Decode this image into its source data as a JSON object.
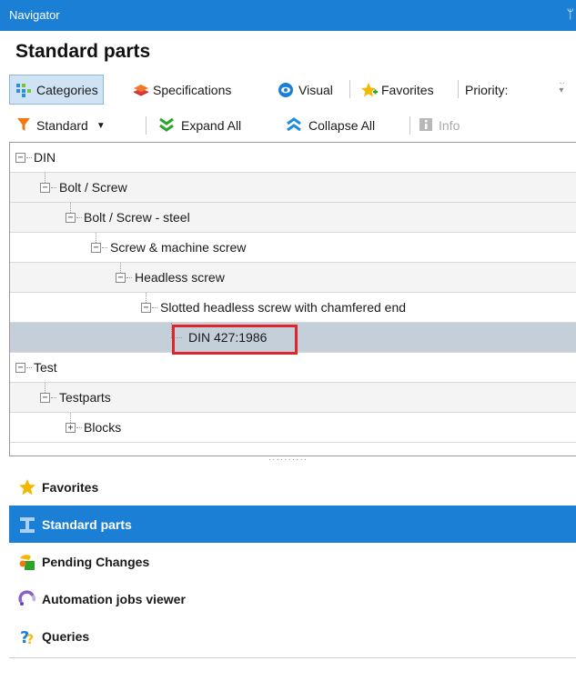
{
  "window": {
    "title": "Navigator",
    "pin_glyph": "ᛘ"
  },
  "panel_title": "Standard parts",
  "tabs": [
    {
      "label": "Categories",
      "icon": "categories-icon",
      "active": true
    },
    {
      "label": "Specifications",
      "icon": "specifications-icon"
    },
    {
      "label": "Visual",
      "icon": "visual-icon"
    },
    {
      "label": "Favorites",
      "icon": "favorites-icon"
    },
    {
      "label": "Priority:",
      "icon": ""
    }
  ],
  "toolbar": {
    "standard": "Standard",
    "expand_all": "Expand  All",
    "collapse_all": "Collapse All",
    "info": "Info"
  },
  "tree": [
    {
      "label": "DIN",
      "level": 0,
      "expander": "−"
    },
    {
      "label": "Bolt / Screw",
      "level": 1,
      "expander": "−"
    },
    {
      "label": "Bolt / Screw - steel",
      "level": 2,
      "expander": "−"
    },
    {
      "label": "Screw & machine screw",
      "level": 3,
      "expander": "−"
    },
    {
      "label": "Headless screw",
      "level": 4,
      "expander": "−"
    },
    {
      "label": "Slotted headless screw with chamfered end",
      "level": 5,
      "expander": "−"
    },
    {
      "label": "DIN 427:1986",
      "level": 6,
      "expander": "",
      "selected": true
    },
    {
      "label": "Test",
      "level": 0,
      "expander": "−"
    },
    {
      "label": "Testparts",
      "level": 1,
      "expander": "−"
    },
    {
      "label": "Blocks",
      "level": 2,
      "expander": "+"
    }
  ],
  "nav": [
    {
      "label": "Favorites",
      "icon": "star-icon"
    },
    {
      "label": "Standard parts",
      "icon": "standard-parts-icon",
      "active": true
    },
    {
      "label": "Pending Changes",
      "icon": "pending-changes-icon"
    },
    {
      "label": "Automation jobs viewer",
      "icon": "automation-icon"
    },
    {
      "label": "Queries",
      "icon": "queries-icon"
    }
  ],
  "colors": {
    "accent": "#1c7fd6",
    "selected_row": "#c4cfd9",
    "highlight_box": "#e0242b"
  }
}
